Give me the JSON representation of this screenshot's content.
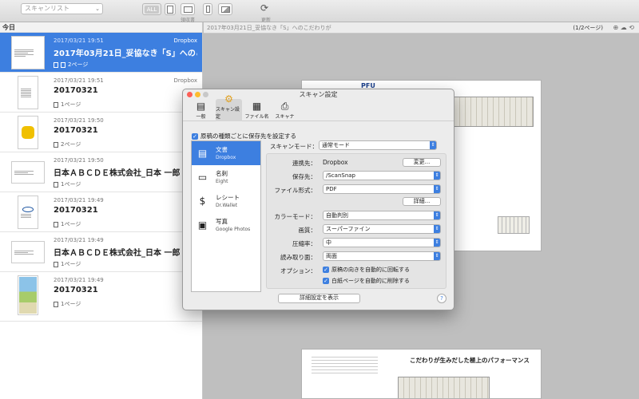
{
  "toolbar": {
    "scan_list_placeholder": "スキャンリスト",
    "all_label": "ALL",
    "receipt_label": "領収書",
    "refresh_label": "更新"
  },
  "sidebar": {
    "section_today": "今日",
    "items": [
      {
        "date": "2017/03/21 19:51",
        "source": "Dropbox",
        "title": "2017年03月21日_妥協なき「S」へのこだわ…",
        "pages": "2ページ"
      },
      {
        "date": "2017/03/21 19:51",
        "source": "Dropbox",
        "title": "20170321",
        "pages": "1ページ"
      },
      {
        "date": "2017/03/21 19:50",
        "source": "D",
        "title": "20170321",
        "pages": "2ページ"
      },
      {
        "date": "2017/03/21 19:50",
        "source": "D",
        "title": "日本ＡＢＣＤＥ株式会社_日本 一郎",
        "pages": "1ページ"
      },
      {
        "date": "2017/03/21 19:49",
        "source": "D",
        "title": "20170321",
        "pages": "1ページ"
      },
      {
        "date": "2017/03/21 19:49",
        "source": "D",
        "title": "日本ＡＢＣＤＥ株式会社_日本 一郎",
        "pages": "1ページ"
      },
      {
        "date": "2017/03/21 19:49",
        "source": "D",
        "title": "20170321",
        "pages": "1ページ"
      }
    ]
  },
  "viewer": {
    "header_title": "2017年03月21日_妥協なき「S」へのこだわりが",
    "pager": "(1/2ページ)",
    "page2_heading": "こだわりが生みだした極上のパフォーマンス",
    "page1_logo": "PFU"
  },
  "dialog": {
    "title": "スキャン設定",
    "tabs": [
      {
        "label": "一般"
      },
      {
        "label": "スキャン設定"
      },
      {
        "label": "ファイル名"
      },
      {
        "label": "スキャナ"
      }
    ],
    "per_type_label": "原稿の種類ごとに保存先を設定する",
    "categories": [
      {
        "name": "文書",
        "service": "Dropbox"
      },
      {
        "name": "名刺",
        "service": "Eight"
      },
      {
        "name": "レシート",
        "service": "Dr.Wallet"
      },
      {
        "name": "写真",
        "service": "Google Photos"
      }
    ],
    "scan_mode_label": "スキャンモード：",
    "scan_mode_value": "通常モード",
    "link_label": "連携先：",
    "link_value": "Dropbox",
    "change_button": "変更...",
    "save_to_label": "保存先：",
    "save_to_value": "/ScanSnap",
    "file_format_label": "ファイル形式：",
    "file_format_value": "PDF",
    "details_button": "詳細...",
    "color_mode_label": "カラーモード：",
    "color_mode_value": "自動判別",
    "quality_label": "画質：",
    "quality_value": "スーパーファイン",
    "compression_label": "圧縮率：",
    "compression_value": "中",
    "reading_side_label": "読み取り面：",
    "reading_side_value": "両面",
    "options_label": "オプション：",
    "option_rotate": "原稿の向きを自動的に回転する",
    "option_blank": "白紙ページを自動的に削除する",
    "show_details_button": "詳細設定を表示",
    "help": "?"
  },
  "colors": {
    "accent": "#3d7fe0",
    "close": "#fc5f57",
    "minimize": "#fdbc2e",
    "maximize": "#c8c8c8"
  }
}
